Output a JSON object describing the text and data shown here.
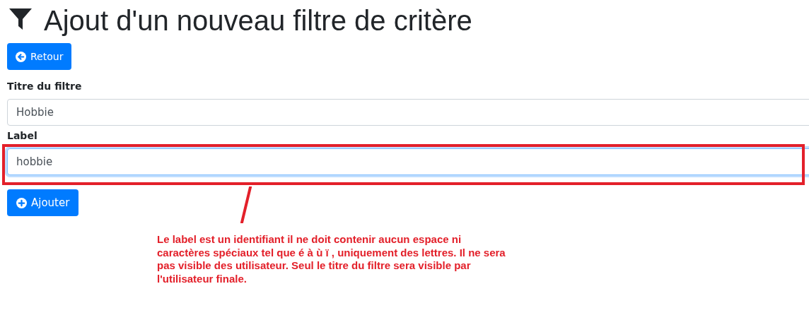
{
  "heading": "Ajout d'un nouveau filtre de critère",
  "back_button": "Retour",
  "fields": [
    {
      "label": "Titre du filtre",
      "value": "Hobbie",
      "focused": false
    },
    {
      "label": "Label",
      "value": "hobbie",
      "focused": true
    }
  ],
  "add_button": "Ajouter",
  "annotation": {
    "text": "Le label est un identifiant il ne doit contenir aucun espace ni caractères spéciaux tel que é à ù ï , uniquement des lettres. Il ne sera pas visible des utilisateur. Seul le titre du filtre sera visible par l'utilisateur finale."
  }
}
